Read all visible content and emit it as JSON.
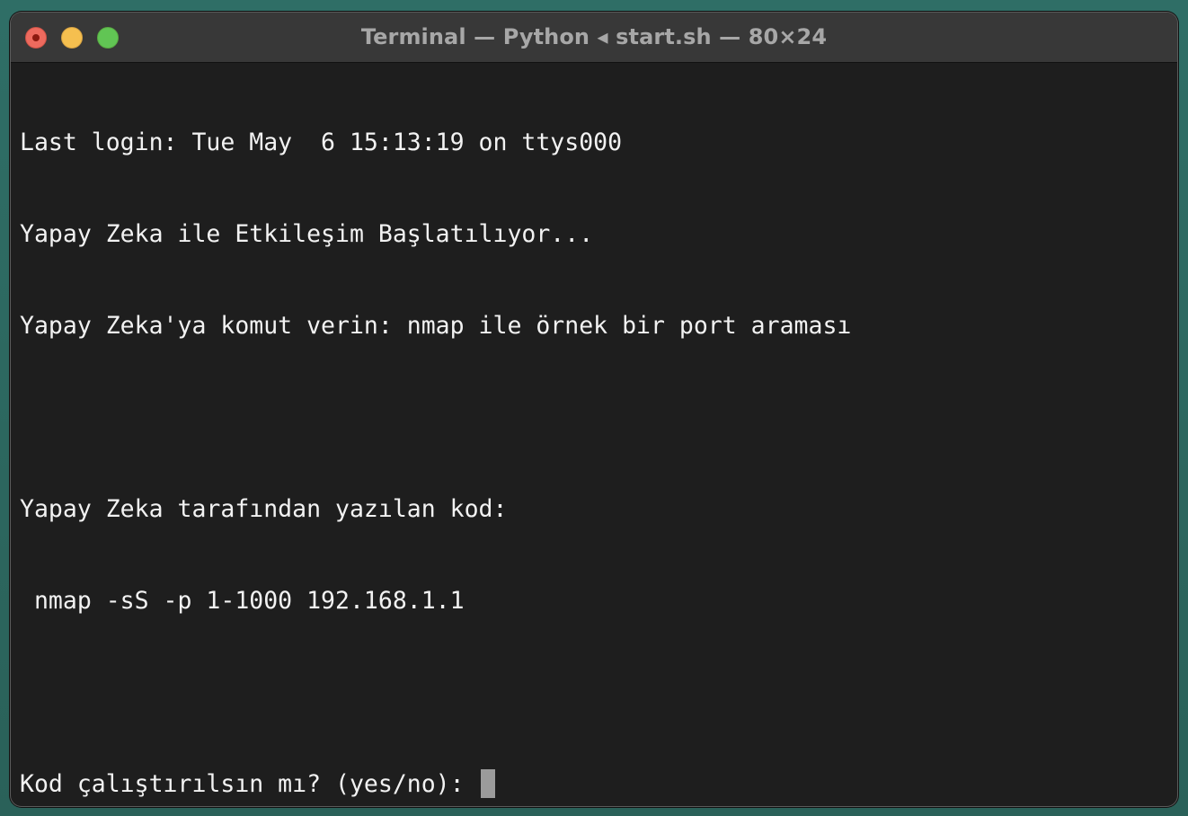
{
  "window": {
    "title": "Terminal — Python ◂ start.sh — 80×24"
  },
  "terminal": {
    "lines": [
      "Last login: Tue May  6 15:13:19 on ttys000",
      "Yapay Zeka ile Etkileşim Başlatılıyor...",
      "Yapay Zeka'ya komut verin: nmap ile örnek bir port araması",
      "",
      "Yapay Zeka tarafından yazılan kod:",
      " nmap -sS -p 1-1000 192.168.1.1",
      "",
      "Kod çalıştırılsın mı? (yes/no): "
    ]
  }
}
